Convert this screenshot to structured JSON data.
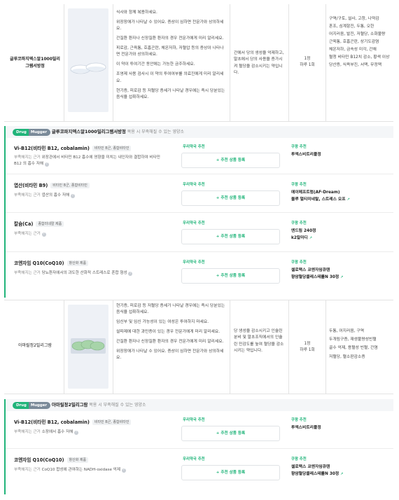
{
  "colors": {
    "accent": "#21b47a",
    "mugger": "#7a8a99"
  },
  "drugs": [
    {
      "name": "글루코파지엑스알1000밀리그램서방정",
      "precautions": [
        "식사와 함께 복용하세요.",
        "위장장애가 나타날 수 있어요. 증상이 심하면 전문가와 상의하세요.",
        "간질환 환자나 신장질환 환자의 경우 전문가에게 미리 알리세요.",
        "피로감, 근육통, 호흡곤란, 체온저하, 저혈압 등의 증상이 나타나면 전문가와 상의하세요.",
        "이 약이 투여기간 동안에는 가능한 금주하세요.",
        "조영제 사용 검사시 이 약의 투여여부를 의료진에게 미리 알리세요.",
        "현기증, 피로감 등 저혈당 증세가 나타날 경우에는 즉시 당분있는 음식을 섭취하세요."
      ],
      "effect": "간에서 당의 생성을 억제하고, 말초에서 당의 사용을 증가시켜 혈당을 감소시키는 약입니다.",
      "dosage_count": "1정",
      "dosage_freq": "하루 1회",
      "side_effects": [
        "구역/구토, 설사, 고창, 나약감",
        "혼조, 심계항진, 두통, 오한",
        "어지러움, 발진, 저혈당, 소화불량",
        "근육통, 호흡곤란, 상기도감염",
        "체온저하, 금속성 미각, 간채",
        "혈청 비타민 B12치 감소, 황색 이상",
        "당산증, 식욕부진, 서맥, 무정맥"
      ]
    },
    {
      "name": "아마릴정2밀리그람",
      "precautions": [
        "현기증, 피로감 등 저혈당 증세가 나타날 경우에는 즉시 당분있는 음식을 섭취하세요.",
        "임신부 및 임신 가능성이 있는 여성은 투여하지 마세요.",
        "설파제에 대한 과민증이 있는 경우 전문가에게 미리 알리세요.",
        "간질환 환자나 신장질환 환자의 경우 전문가에게 미리 알리세요.",
        "위장장애가 나타날 수 있어요. 증상이 심하면 전문가와 상의하세요."
      ],
      "effect": "당 생성을 감소시키고 인슐린 분비 및 말초조직에서의 인슐린 민감도를 높여 혈당을 감소시키는 약입니다.",
      "dosage_count": "1정",
      "dosage_freq": "하루 1회",
      "side_effects": [
        "두통, 어지러움, 구역",
        "두개림구증, 재생불량성빈혈",
        "골수 억제, 용혈성 빈혈, 간염",
        "저혈당, 혈소판감소증"
      ]
    }
  ],
  "panels": [
    {
      "tag_drug": "Drug",
      "tag_mugger": "Mugger",
      "title": "글루코파지엑스알1000밀리그램서방정",
      "subtitle": "복용 시 부족해질 수 있는 영양소",
      "rec_label": "우리약국 추천",
      "rec_btn": "+ 추천 상품 등록",
      "coupang_label": "쿠팡 추천",
      "nutrients": [
        {
          "name": "Vi-B12(비타민 B12, cobalamin)",
          "chip": "비타민 B군, 종합비타민",
          "reason_label": "부족해지는 근거",
          "reason": "위장관에서 비타민 B12 흡수에 영향을 미치는 내인자와 결합하여 비타민 B12 의 흡수 저해",
          "products": [
            "투엑스비트리플정"
          ]
        },
        {
          "name": "엽산(비타민 B9)",
          "chip": "비타민 B군, 종합비타민",
          "reason_label": "부족해지는 근거",
          "reason": "엽산의 흡수 저해",
          "products": [
            "에이메프트럼(AF-Dream)",
            "블루 멀티미네랄, 스트레스 오프"
          ]
        },
        {
          "name": "칼슘(Ca)",
          "chip": "종합미네랄 제품",
          "reason_label": "부족해지는 근거",
          "reason": "",
          "products": [
            "엔드림 240정",
            "k2칼마디"
          ]
        },
        {
          "name": "코엔자임 Q10(CoQ10)",
          "chip": "항산화 제품",
          "reason_label": "부족해지는 근거",
          "reason": "당뇨환자에서의 과도한 산화적 스트레스로 혼합 형성",
          "products": [
            "셀로맥스 코엔자임큐텐",
            "향암혈당콜레스테롤N 30정"
          ]
        }
      ]
    },
    {
      "tag_drug": "Drug",
      "tag_mugger": "Mugger",
      "title": "아마릴정2밀리그람",
      "subtitle": "복용 시 부족해질 수 있는 영양소",
      "rec_label": "우리약국 추천",
      "rec_btn": "+ 추천 상품 등록",
      "coupang_label": "쿠팡 추천",
      "nutrients": [
        {
          "name": "Vi-B12(비타민 B12, cobalamin)",
          "chip": "비타민 B군, 종합비타민",
          "reason_label": "부족해지는 근거",
          "reason": "소장에서 흡수 저해",
          "products": [
            "투엑스비트리플정"
          ]
        },
        {
          "name": "코엔자임 Q10(CoQ10)",
          "chip": "항산화 제품",
          "reason_label": "부족해지는 근거",
          "reason": "CoQ10 합성에 관여하는 NADH-oxidase 억제",
          "products": [
            "셀로맥스 코엔자임큐텐",
            "향암혈당콜레스테롤N 30정"
          ]
        }
      ]
    }
  ]
}
